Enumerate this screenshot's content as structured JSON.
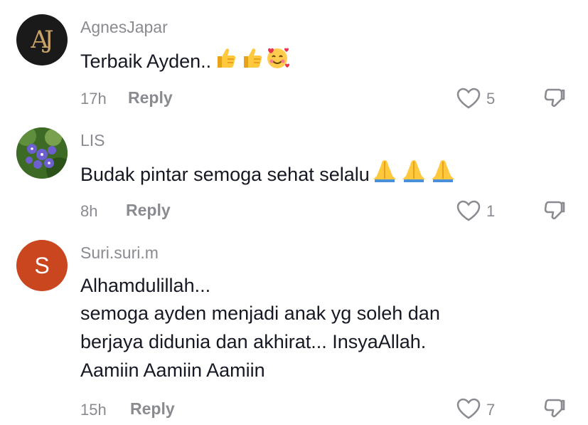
{
  "comments": [
    {
      "username": "AgnesJapar",
      "avatar_text": "AJ",
      "avatar_icon": "monogram-logo",
      "text": "Terbaik Ayden..",
      "emojis": [
        "thumbs-up",
        "thumbs-up",
        "smiling-face-with-hearts"
      ],
      "time": "17h",
      "reply_label": "Reply",
      "likes": "5"
    },
    {
      "username": "LIS",
      "avatar_icon": "flower-photo",
      "text": "Budak pintar semoga sehat selalu",
      "emojis": [
        "folded-hands",
        "folded-hands",
        "folded-hands"
      ],
      "time": "8h",
      "reply_label": "Reply",
      "likes": "1"
    },
    {
      "username": "Suri.suri.m",
      "avatar_text": "S",
      "avatar_icon": "letter-avatar",
      "lines": [
        "Alhamdulillah...",
        "semoga ayden menjadi anak yg soleh dan",
        "berjaya didunia dan akhirat... InsyaAllah.",
        "Aamiin Aamiin Aamiin"
      ],
      "time": "15h",
      "reply_label": "Reply",
      "likes": "7"
    }
  ],
  "colors": {
    "text": "#161823",
    "muted": "#8a8b91",
    "avatar_s": "#c9461f",
    "avatar_aj_bg": "#1a1a1a",
    "avatar_aj_gold": "#c8a266"
  }
}
